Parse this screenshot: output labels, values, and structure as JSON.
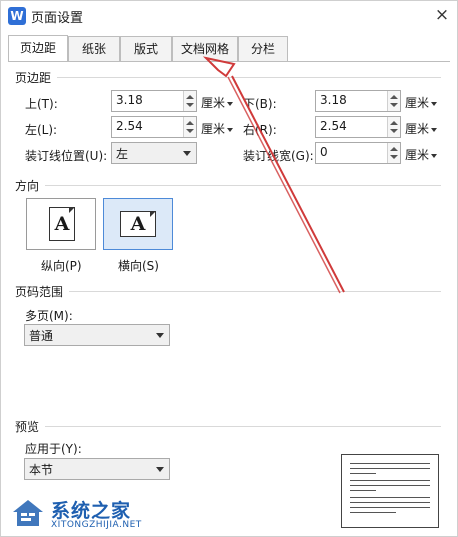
{
  "window": {
    "app_icon": "W",
    "title": "页面设置",
    "close_icon": "×"
  },
  "tabs": [
    {
      "label": "页边距",
      "active": true
    },
    {
      "label": "纸张",
      "active": false
    },
    {
      "label": "版式",
      "active": false
    },
    {
      "label": "文档网格",
      "active": false
    },
    {
      "label": "分栏",
      "active": false
    }
  ],
  "margins": {
    "group_title": "页边距",
    "top": {
      "label": "上(T):",
      "value": "3.18",
      "unit": "厘米"
    },
    "bottom": {
      "label": "下(B):",
      "value": "3.18",
      "unit": "厘米"
    },
    "left": {
      "label": "左(L):",
      "value": "2.54",
      "unit": "厘米"
    },
    "right": {
      "label": "右(R):",
      "value": "2.54",
      "unit": "厘米"
    },
    "gutter_position": {
      "label": "装订线位置(U):",
      "value": "左"
    },
    "gutter_width": {
      "label": "装订线宽(G):",
      "value": "0",
      "unit": "厘米"
    }
  },
  "orientation": {
    "group_title": "方向",
    "portrait": {
      "label": "纵向(P)",
      "glyph": "A"
    },
    "landscape": {
      "label": "横向(S)",
      "glyph": "A",
      "selected": true
    }
  },
  "pages": {
    "group_title": "页码范围",
    "multiple_label": "多页(M):",
    "multiple_value": "普通"
  },
  "preview": {
    "group_title": "预览",
    "apply_to_label": "应用于(Y):",
    "apply_to_value": "本节"
  },
  "watermark": {
    "text": "系统之家",
    "sub": "XITONGZHIJIA.NET"
  },
  "colors": {
    "annotation_arrow": "#d03a3a",
    "selected_border": "#4d8ad8",
    "watermark": "#1e5fb0"
  }
}
